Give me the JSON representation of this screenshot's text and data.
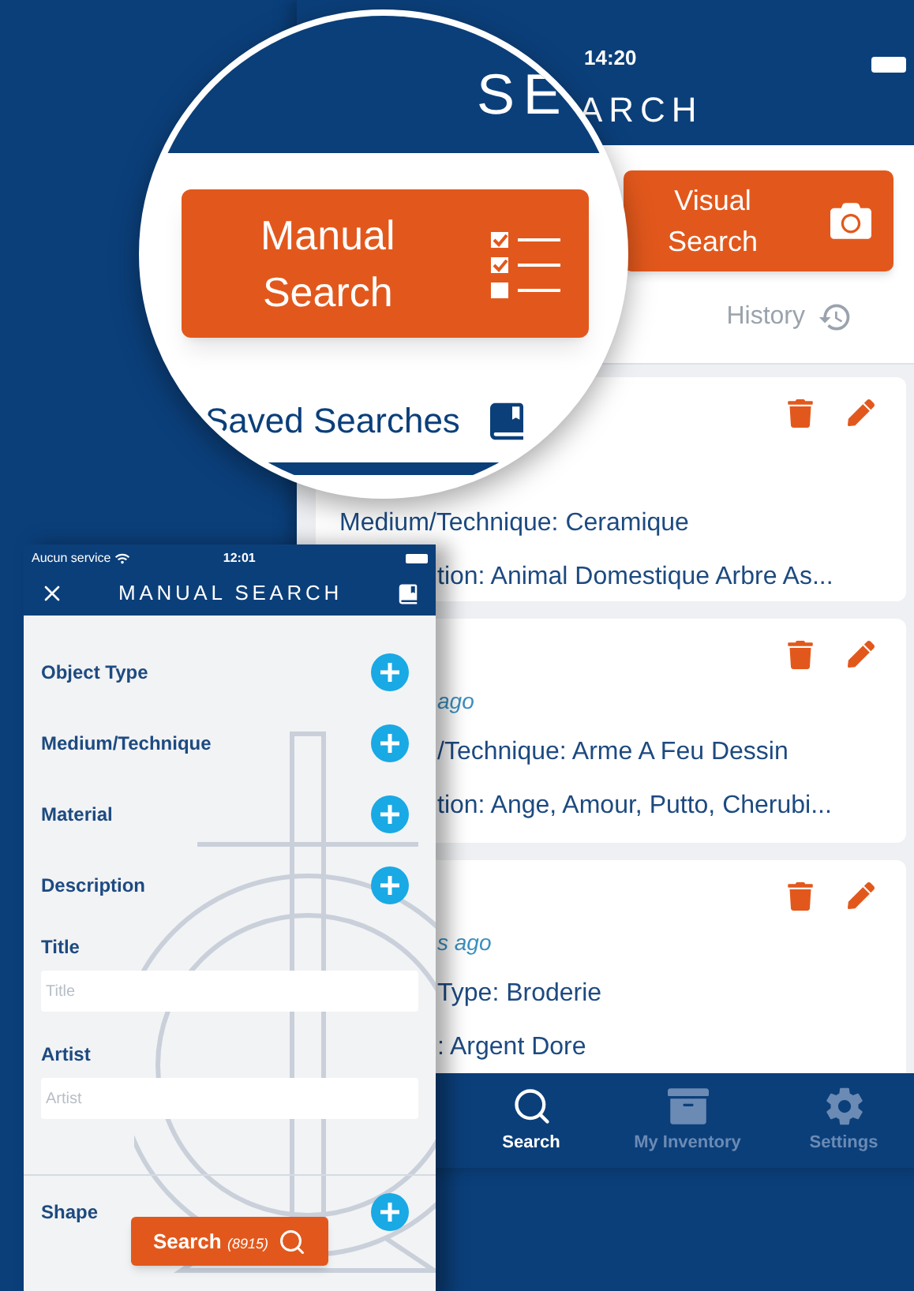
{
  "background_screen": {
    "status_bar": {
      "time": "14:20"
    },
    "title": "ARCH",
    "visual_search_button": {
      "label_lines": [
        "Visual",
        "Search"
      ]
    },
    "tabs": [
      {
        "label": "History",
        "selected": false
      }
    ],
    "saved_searches": [
      {
        "lines": [
          {
            "kind": "field",
            "text": "Medium/Technique: Ceramique",
            "covered": false
          },
          {
            "kind": "field",
            "text": "tion: Animal Domestique Arbre As...",
            "covered": true
          }
        ]
      },
      {
        "lines": [
          {
            "kind": "time",
            "text": "ago",
            "covered": true
          },
          {
            "kind": "field",
            "text": "/Technique: Arme A Feu Dessin",
            "covered": true
          },
          {
            "kind": "field",
            "text": "tion: Ange, Amour, Putto, Cherubi...",
            "covered": true
          }
        ]
      },
      {
        "lines": [
          {
            "kind": "time",
            "text": "s ago",
            "covered": true
          },
          {
            "kind": "field",
            "text": "Type: Broderie",
            "covered": true
          },
          {
            "kind": "field",
            "text": ": Argent Dore",
            "covered": true
          }
        ]
      }
    ],
    "bottom_nav": [
      {
        "kind": "search",
        "label": "Search",
        "selected": true
      },
      {
        "kind": "inventory",
        "label": "My Inventory",
        "selected": false
      },
      {
        "kind": "settings",
        "label": "Settings",
        "selected": false
      }
    ]
  },
  "magnifier": {
    "title": "SE",
    "manual_search_button": {
      "label_lines": [
        "Manual",
        "Search"
      ]
    },
    "tabs": [
      {
        "label": "Saved Searches",
        "selected": true
      }
    ]
  },
  "manual_search_screen": {
    "status_bar": {
      "carrier": "Aucun service",
      "time": "12:01"
    },
    "title": "MANUAL SEARCH",
    "fields": [
      {
        "kind": "picker",
        "label": "Object Type"
      },
      {
        "kind": "picker",
        "label": "Medium/Technique"
      },
      {
        "kind": "picker",
        "label": "Material"
      },
      {
        "kind": "picker",
        "label": "Description"
      },
      {
        "kind": "text",
        "label": "Title",
        "placeholder": "Title"
      },
      {
        "kind": "text",
        "label": "Artist",
        "placeholder": "Artist"
      },
      {
        "kind": "divider"
      },
      {
        "kind": "picker",
        "label": "Shape"
      }
    ],
    "search_button": {
      "label": "Search",
      "count": "(8915)"
    }
  }
}
